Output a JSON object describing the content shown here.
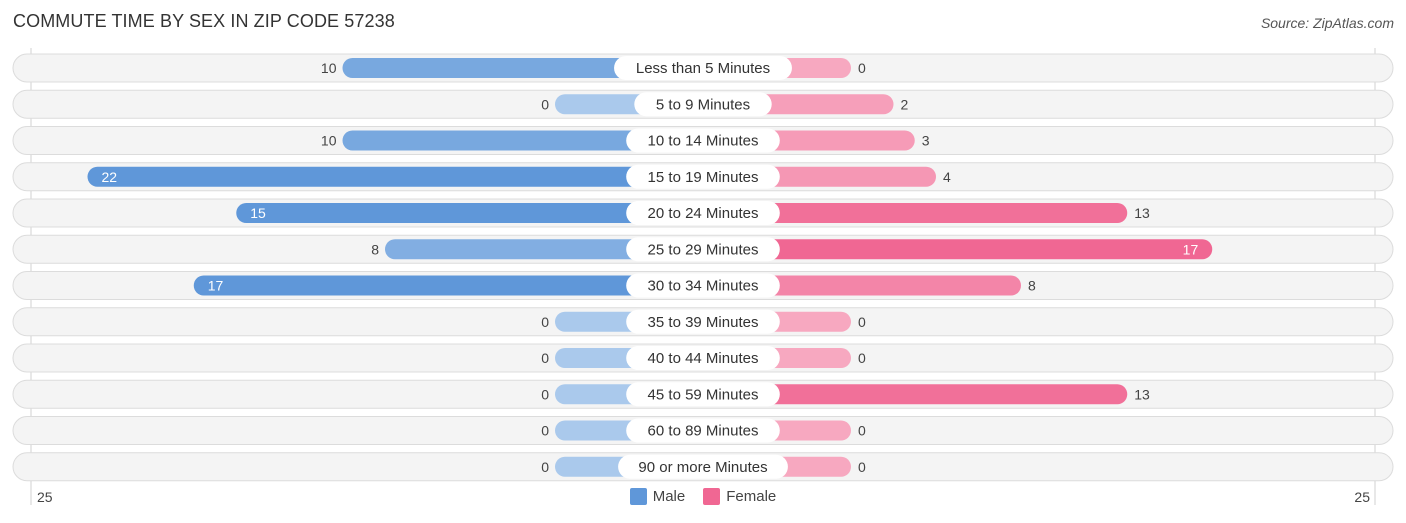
{
  "header": {
    "title": "COMMUTE TIME BY SEX IN ZIP CODE 57238",
    "source": "Source: ZipAtlas.com"
  },
  "colors": {
    "male_strong": "#5f97d9",
    "male_light": "#aac9ec",
    "female_strong": "#f06793",
    "female_light": "#f7a8c0",
    "row_bg": "#f4f4f4",
    "row_border": "#dcdcdc"
  },
  "chart_data": {
    "type": "bar",
    "orientation": "horizontal-diverging",
    "title": "COMMUTE TIME BY SEX IN ZIP CODE 57238",
    "categories": [
      "Less than 5 Minutes",
      "5 to 9 Minutes",
      "10 to 14 Minutes",
      "15 to 19 Minutes",
      "20 to 24 Minutes",
      "25 to 29 Minutes",
      "30 to 34 Minutes",
      "35 to 39 Minutes",
      "40 to 44 Minutes",
      "45 to 59 Minutes",
      "60 to 89 Minutes",
      "90 or more Minutes"
    ],
    "series": [
      {
        "name": "Male",
        "values": [
          10,
          0,
          10,
          22,
          15,
          8,
          17,
          0,
          0,
          0,
          0,
          0
        ]
      },
      {
        "name": "Female",
        "values": [
          0,
          2,
          3,
          4,
          13,
          17,
          8,
          0,
          0,
          13,
          0,
          0
        ]
      }
    ],
    "xlim": [
      -25,
      25
    ],
    "axis_tick_left": "25",
    "axis_tick_right": "25",
    "legend": {
      "position": "bottom-center",
      "entries": [
        "Male",
        "Female"
      ]
    },
    "grid": false
  }
}
